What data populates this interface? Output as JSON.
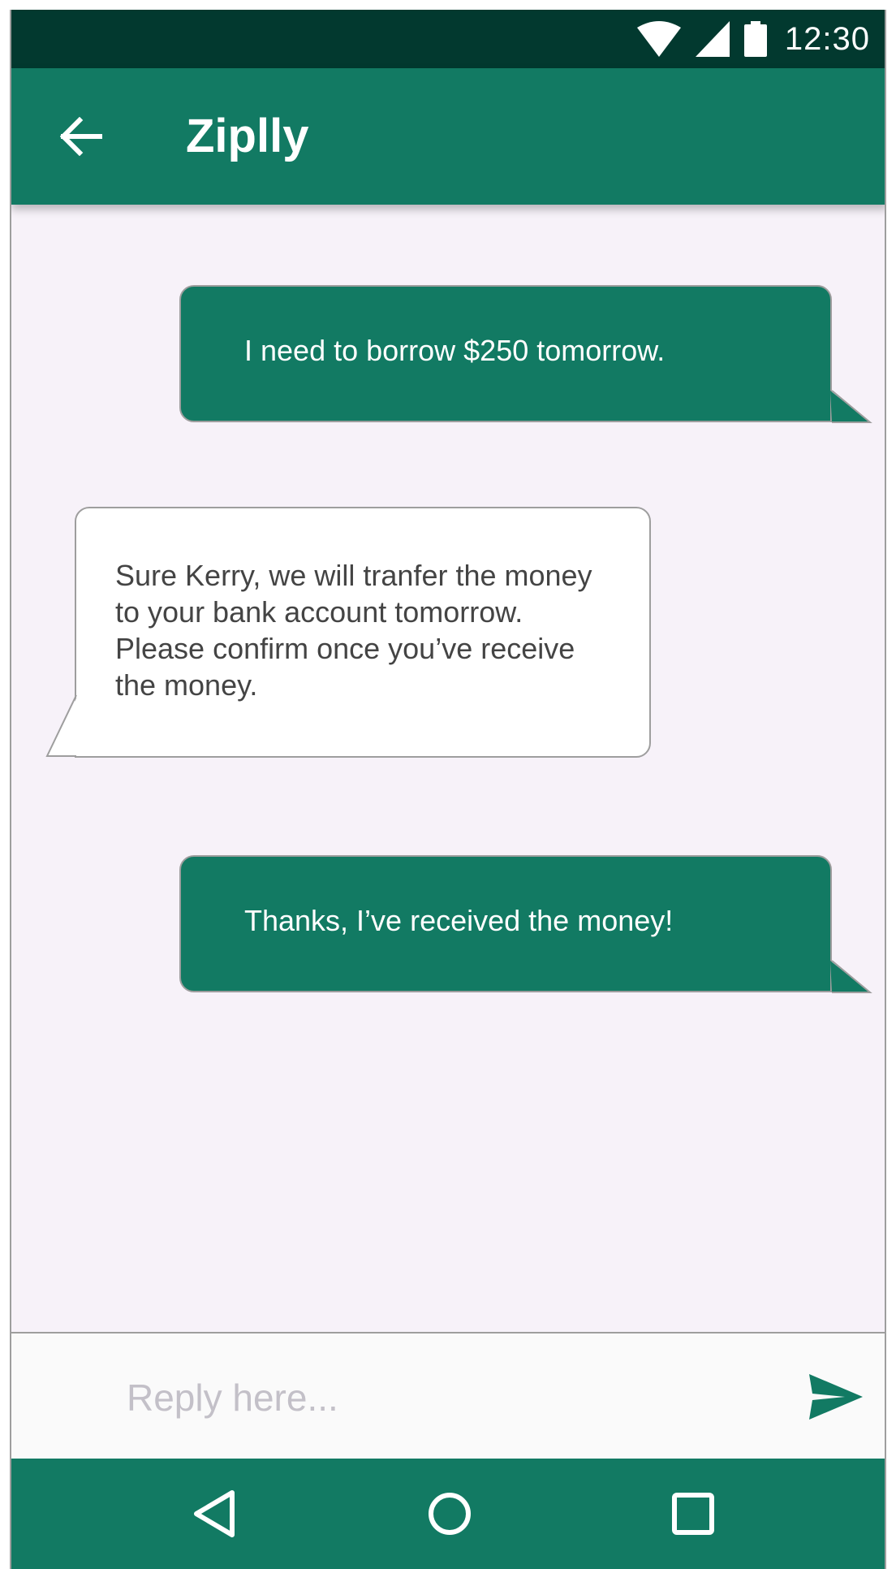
{
  "status_bar": {
    "time": "12:30",
    "icons": [
      "wifi-icon",
      "cellular-signal-icon",
      "battery-icon"
    ]
  },
  "app_bar": {
    "title": "Ziplly",
    "back_icon": "arrow-left-icon"
  },
  "messages": [
    {
      "direction": "outgoing",
      "text": "I need to borrow $250 tomorrow."
    },
    {
      "direction": "incoming",
      "lines": [
        "Sure Kerry, we will tranfer the money",
        "to your bank account tomorrow.",
        "Please confirm once you’ve receive",
        "the money."
      ]
    },
    {
      "direction": "outgoing",
      "text": "Thanks, I’ve received the money!"
    }
  ],
  "reply": {
    "placeholder": "Reply here...",
    "value": "",
    "send_icon": "send-icon"
  },
  "nav_bar": {
    "items": [
      "back-triangle-icon",
      "home-circle-icon",
      "recents-square-icon"
    ]
  },
  "colors": {
    "primary": "#127a63",
    "status_bar": "#02392f",
    "background": "#f7f2f9",
    "incoming_bubble": "#ffffff",
    "incoming_text": "#444444",
    "placeholder": "#c3c0c8"
  }
}
